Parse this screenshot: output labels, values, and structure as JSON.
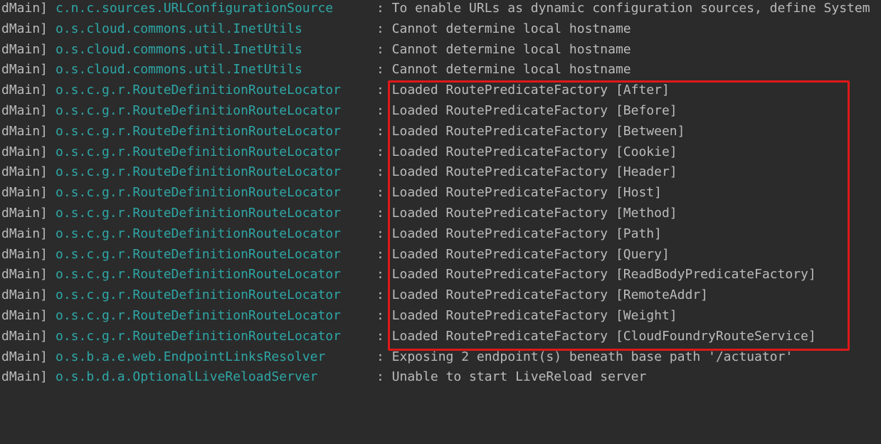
{
  "console": {
    "lines": [
      {
        "thread": "dMain]",
        "logger": "c.n.c.sources.URLConfigurationSource",
        "message": ": To enable URLs as dynamic configuration sources, define System"
      },
      {
        "thread": "dMain]",
        "logger": "o.s.cloud.commons.util.InetUtils",
        "message": ": Cannot determine local hostname"
      },
      {
        "thread": "dMain]",
        "logger": "o.s.cloud.commons.util.InetUtils",
        "message": ": Cannot determine local hostname"
      },
      {
        "thread": "dMain]",
        "logger": "o.s.cloud.commons.util.InetUtils",
        "message": ": Cannot determine local hostname"
      },
      {
        "thread": "dMain]",
        "logger": "o.s.c.g.r.RouteDefinitionRouteLocator",
        "message": ": Loaded RoutePredicateFactory [After]"
      },
      {
        "thread": "dMain]",
        "logger": "o.s.c.g.r.RouteDefinitionRouteLocator",
        "message": ": Loaded RoutePredicateFactory [Before]"
      },
      {
        "thread": "dMain]",
        "logger": "o.s.c.g.r.RouteDefinitionRouteLocator",
        "message": ": Loaded RoutePredicateFactory [Between]"
      },
      {
        "thread": "dMain]",
        "logger": "o.s.c.g.r.RouteDefinitionRouteLocator",
        "message": ": Loaded RoutePredicateFactory [Cookie]"
      },
      {
        "thread": "dMain]",
        "logger": "o.s.c.g.r.RouteDefinitionRouteLocator",
        "message": ": Loaded RoutePredicateFactory [Header]"
      },
      {
        "thread": "dMain]",
        "logger": "o.s.c.g.r.RouteDefinitionRouteLocator",
        "message": ": Loaded RoutePredicateFactory [Host]"
      },
      {
        "thread": "dMain]",
        "logger": "o.s.c.g.r.RouteDefinitionRouteLocator",
        "message": ": Loaded RoutePredicateFactory [Method]"
      },
      {
        "thread": "dMain]",
        "logger": "o.s.c.g.r.RouteDefinitionRouteLocator",
        "message": ": Loaded RoutePredicateFactory [Path]"
      },
      {
        "thread": "dMain]",
        "logger": "o.s.c.g.r.RouteDefinitionRouteLocator",
        "message": ": Loaded RoutePredicateFactory [Query]"
      },
      {
        "thread": "dMain]",
        "logger": "o.s.c.g.r.RouteDefinitionRouteLocator",
        "message": ": Loaded RoutePredicateFactory [ReadBodyPredicateFactory]"
      },
      {
        "thread": "dMain]",
        "logger": "o.s.c.g.r.RouteDefinitionRouteLocator",
        "message": ": Loaded RoutePredicateFactory [RemoteAddr]"
      },
      {
        "thread": "dMain]",
        "logger": "o.s.c.g.r.RouteDefinitionRouteLocator",
        "message": ": Loaded RoutePredicateFactory [Weight]"
      },
      {
        "thread": "dMain]",
        "logger": "o.s.c.g.r.RouteDefinitionRouteLocator",
        "message": ": Loaded RoutePredicateFactory [CloudFoundryRouteService]"
      },
      {
        "thread": "dMain]",
        "logger": "o.s.b.a.e.web.EndpointLinksResolver",
        "message": ": Exposing 2 endpoint(s) beneath base path '/actuator'"
      },
      {
        "thread": "dMain]",
        "logger": "o.s.b.d.a.OptionalLiveReloadServer",
        "message": ": Unable to start LiveReload server"
      }
    ]
  },
  "colors": {
    "background": "#2b2b2b",
    "text": "#bbbbbb",
    "logger": "#2fa6a6",
    "highlight": "#e01818"
  }
}
